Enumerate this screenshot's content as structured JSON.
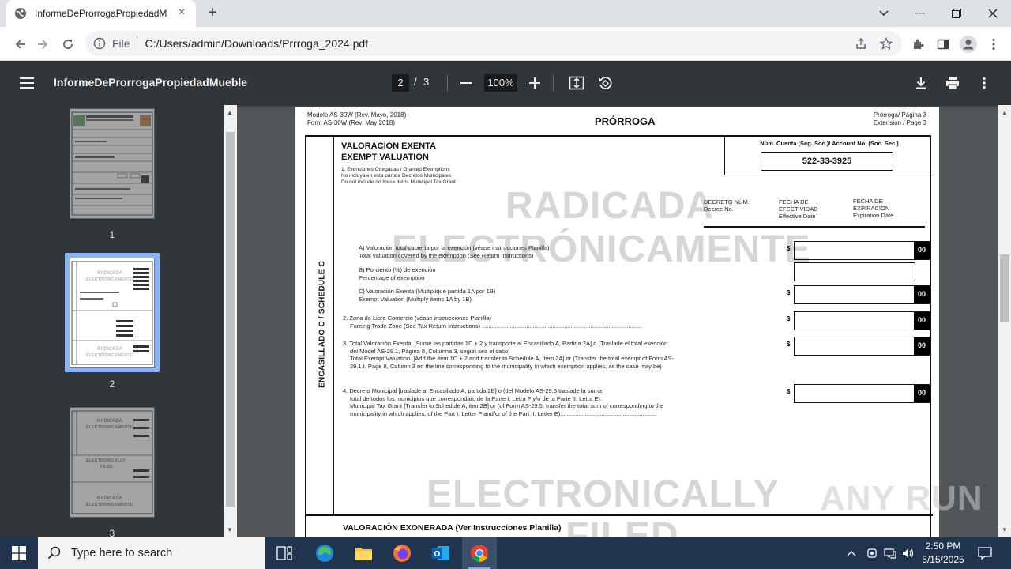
{
  "browser": {
    "tab_title": "InformeDeProrrogaPropiedadM",
    "new_tab": "+",
    "url_scheme": "File",
    "url": "C:/Users/admin/Downloads/Prrroga_2024.pdf"
  },
  "viewer": {
    "doc_title": "InformeDeProrrogaPropiedadMueble",
    "current_page": "2",
    "page_sep": "/",
    "total_pages": "3",
    "zoom": "100%"
  },
  "thumbnails": [
    {
      "label": "1"
    },
    {
      "label": "2",
      "selected": true
    },
    {
      "label": "3"
    }
  ],
  "thumb_watermarks": {
    "radicada": "RADICADA",
    "electronicamente": "ELECTRÓNICAMENTE",
    "electronically": "ELECTRONICALLY",
    "filed": "FILED"
  },
  "document": {
    "header_left_1": "Modelo AS-30W (Rev. Mayo, 2018)",
    "header_left_2": "Form AS-30W  (Rev. May 2018)",
    "header_center": "PRÓRROGA",
    "header_right_1": "Prórroga/ Página 3",
    "header_right_2": "Extension / Page 3",
    "schedule_label": "ENCASILLADO C / SCHEDULE C",
    "section_title_1": "VALORACIÓN EXENTA",
    "section_title_2": "EXEMPT VALUATION",
    "section_sub_1": "1. Exenciones Otorgadas / Granted Exemptions",
    "section_sub_2": "No incluya en esta partida Decretos Municipales",
    "section_sub_3": "Do not include on these items Municipal Tax Grant",
    "account_label": "Núm. Cuenta (Seg. Soc.)/ Account No. (Soc. Sec.)",
    "account_value": "522-33-3925",
    "col_decree_1": "DECRETO NÚM.",
    "col_decree_2": "Decree No.",
    "col_effective_1": "FECHA DE",
    "col_effective_2": "EFECTIVIDAD",
    "col_effective_3": "Effective Date",
    "col_expiration_1": "FECHA DE",
    "col_expiration_2": "EXPIRACION",
    "col_expiration_3": "Expiration Date",
    "item_a_1": "A) Valoración total cubierta por la exención (véase instrucciones Planilla)",
    "item_a_2": "Total valuation covered by the exemption (See Return Instructions)",
    "item_b_1": "B) Porciento (%) de exención",
    "item_b_2": "Percentage of exemption",
    "item_c_1": "C) Valoración Exenta (Multiplique partida 1A por 1B)",
    "item_c_2": "Exempt Valuation (Multiply items 1A by 1B)",
    "item_2_1": "2. Zona de Libre Comercio (véase instrucciones Planilla)",
    "item_2_2": "Foreing Trade Zone (See Tax Return Instructions) .................................................................................................",
    "item_3_1": "3. Total Valoración Exenta. [Sume las partidas 1C + 2 y transporte al Encasillado A, Partida 2A] ó (Traslade el total exención",
    "item_3_2": "del Model AS-29.1, Página 8, Columna 3, según sea el caso)",
    "item_3_3": "Total Exempt Valuation. [Add the item 1C + 2 and transfer to Schedule A, Item 2A] or (Transfer the total exempt of Form AS-",
    "item_3_4": "29.1.I, Page 8, Column 3 on the line corresponding to the municipality in which exemption applies, as the case may be)",
    "item_4_1": "4. Decreto Municipal [traslade al Encasillado A, partida 2B] o (del Modelo AS-29.5 traslade la suma",
    "item_4_2": "total de todos los municipios que correspondan, de la Parte I, Letra F y/o de la Parte II, Letra E).",
    "item_4_3": "Municipal Tax Grant [Transfer to Schedule A, item2B] or (of Form AS-29.5, transfer the total sum of corresponding to the",
    "item_4_4": "municipality in which applies, of the Part I, Letter F and/or of the Part II, Letter E)..........................................................",
    "dollar": "$",
    "cents": "00",
    "watermark_1": "RADICADA",
    "watermark_2": "ELECTRÓNICAMENTE",
    "watermark_3": "ELECTRONICALLY",
    "watermark_4": "FILED",
    "bottom_section_title": "VALORACIÓN EXONERADA (Ver Instrucciones Planilla)"
  },
  "overlay_brand": "ANY RUN",
  "taskbar": {
    "search_placeholder": "Type here to search",
    "time": "2:50 PM",
    "date": "5/15/2025"
  },
  "colors": {
    "viewer_bg": "#525659",
    "toolbar_bg": "#323639",
    "taskbar_bg": "#20344f",
    "thumb_selected": "#8ab4f8"
  }
}
